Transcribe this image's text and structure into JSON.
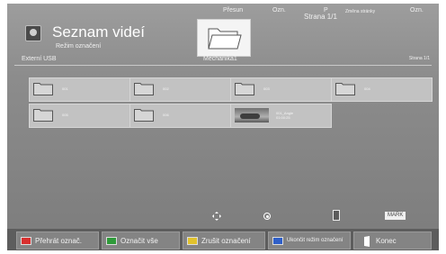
{
  "header": {
    "title": "Seznam videí",
    "mode": "Režim označení",
    "source": "Externí USB",
    "page_top": "Strana 1/1",
    "drive_label": "Mechanika1",
    "page_right": "Strana 1/1"
  },
  "items": [
    {
      "label": "001",
      "kind": "folder"
    },
    {
      "label": "002",
      "kind": "folder"
    },
    {
      "label": "003",
      "kind": "folder"
    },
    {
      "label": "004",
      "kind": "folder"
    },
    {
      "label": "005",
      "kind": "folder"
    },
    {
      "label": "006",
      "kind": "folder"
    },
    {
      "label": "001_Angle",
      "sub": "01:00:25",
      "kind": "video"
    }
  ],
  "hints": {
    "move": "Přesun",
    "ok": "Ozn.",
    "p": "P",
    "page_change": "Změna stránky",
    "mark_key": "MARK",
    "mark": "Ozn."
  },
  "footer": {
    "buttons": [
      {
        "label": "Přehrát označ.",
        "color": "#d8302f"
      },
      {
        "label": "Označit vše",
        "color": "#2f9a3a"
      },
      {
        "label": "Zrušit označení",
        "color": "#e1c22d"
      },
      {
        "label": "Ukončit režim označení",
        "color": "#2f5fc8"
      },
      {
        "label": "Konec",
        "icon": "exit-icon"
      }
    ]
  }
}
